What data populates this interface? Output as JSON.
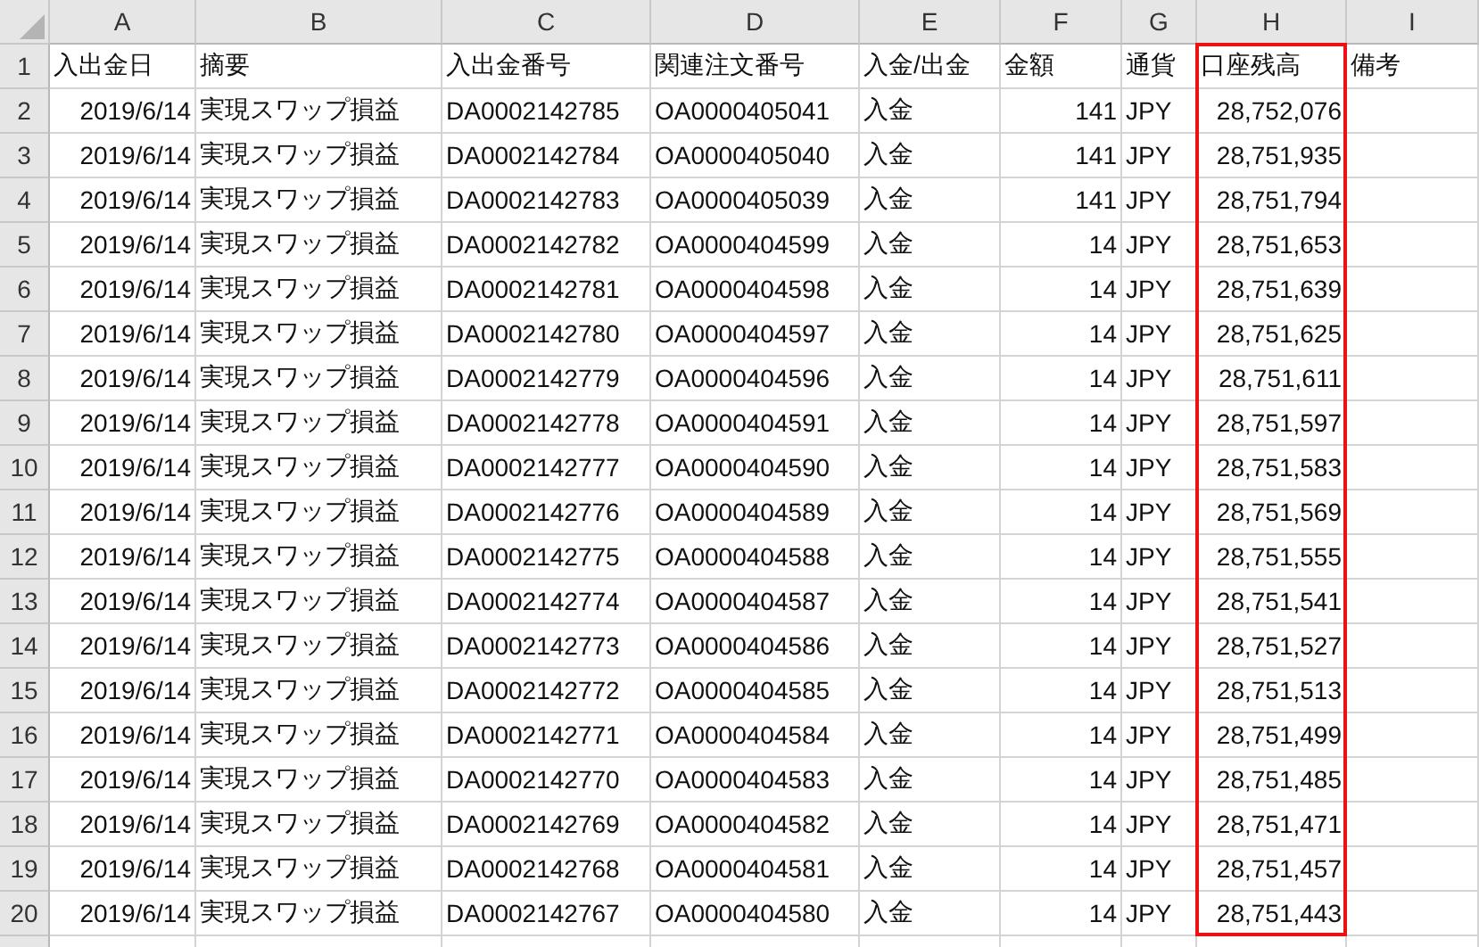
{
  "columns": [
    {
      "letter": "A",
      "highlighted": false
    },
    {
      "letter": "B",
      "highlighted": false
    },
    {
      "letter": "C",
      "highlighted": false
    },
    {
      "letter": "D",
      "highlighted": false
    },
    {
      "letter": "E",
      "highlighted": false
    },
    {
      "letter": "F",
      "highlighted": false
    },
    {
      "letter": "G",
      "highlighted": false
    },
    {
      "letter": "H",
      "highlighted": true
    },
    {
      "letter": "I",
      "highlighted": false
    }
  ],
  "header_row": {
    "number": "1",
    "cells": [
      "入出金日",
      "摘要",
      "入出金番号",
      "関連注文番号",
      "入金/出金",
      "金額",
      "通貨",
      "口座残高",
      "備考"
    ]
  },
  "rows": [
    {
      "number": "2",
      "cells": [
        "2019/6/14",
        "実現スワップ損益",
        "DA0002142785",
        "OA0000405041",
        "入金",
        "141",
        "JPY",
        "28,752,076"
      ]
    },
    {
      "number": "3",
      "cells": [
        "2019/6/14",
        "実現スワップ損益",
        "DA0002142784",
        "OA0000405040",
        "入金",
        "141",
        "JPY",
        "28,751,935"
      ]
    },
    {
      "number": "4",
      "cells": [
        "2019/6/14",
        "実現スワップ損益",
        "DA0002142783",
        "OA0000405039",
        "入金",
        "141",
        "JPY",
        "28,751,794"
      ]
    },
    {
      "number": "5",
      "cells": [
        "2019/6/14",
        "実現スワップ損益",
        "DA0002142782",
        "OA0000404599",
        "入金",
        "14",
        "JPY",
        "28,751,653"
      ]
    },
    {
      "number": "6",
      "cells": [
        "2019/6/14",
        "実現スワップ損益",
        "DA0002142781",
        "OA0000404598",
        "入金",
        "14",
        "JPY",
        "28,751,639"
      ]
    },
    {
      "number": "7",
      "cells": [
        "2019/6/14",
        "実現スワップ損益",
        "DA0002142780",
        "OA0000404597",
        "入金",
        "14",
        "JPY",
        "28,751,625"
      ]
    },
    {
      "number": "8",
      "cells": [
        "2019/6/14",
        "実現スワップ損益",
        "DA0002142779",
        "OA0000404596",
        "入金",
        "14",
        "JPY",
        "28,751,611"
      ]
    },
    {
      "number": "9",
      "cells": [
        "2019/6/14",
        "実現スワップ損益",
        "DA0002142778",
        "OA0000404591",
        "入金",
        "14",
        "JPY",
        "28,751,597"
      ]
    },
    {
      "number": "10",
      "cells": [
        "2019/6/14",
        "実現スワップ損益",
        "DA0002142777",
        "OA0000404590",
        "入金",
        "14",
        "JPY",
        "28,751,583"
      ]
    },
    {
      "number": "11",
      "cells": [
        "2019/6/14",
        "実現スワップ損益",
        "DA0002142776",
        "OA0000404589",
        "入金",
        "14",
        "JPY",
        "28,751,569"
      ]
    },
    {
      "number": "12",
      "cells": [
        "2019/6/14",
        "実現スワップ損益",
        "DA0002142775",
        "OA0000404588",
        "入金",
        "14",
        "JPY",
        "28,751,555"
      ]
    },
    {
      "number": "13",
      "cells": [
        "2019/6/14",
        "実現スワップ損益",
        "DA0002142774",
        "OA0000404587",
        "入金",
        "14",
        "JPY",
        "28,751,541"
      ]
    },
    {
      "number": "14",
      "cells": [
        "2019/6/14",
        "実現スワップ損益",
        "DA0002142773",
        "OA0000404586",
        "入金",
        "14",
        "JPY",
        "28,751,527"
      ]
    },
    {
      "number": "15",
      "cells": [
        "2019/6/14",
        "実現スワップ損益",
        "DA0002142772",
        "OA0000404585",
        "入金",
        "14",
        "JPY",
        "28,751,513"
      ]
    },
    {
      "number": "16",
      "cells": [
        "2019/6/14",
        "実現スワップ損益",
        "DA0002142771",
        "OA0000404584",
        "入金",
        "14",
        "JPY",
        "28,751,499"
      ]
    },
    {
      "number": "17",
      "cells": [
        "2019/6/14",
        "実現スワップ損益",
        "DA0002142770",
        "OA0000404583",
        "入金",
        "14",
        "JPY",
        "28,751,485"
      ]
    },
    {
      "number": "18",
      "cells": [
        "2019/6/14",
        "実現スワップ損益",
        "DA0002142769",
        "OA0000404582",
        "入金",
        "14",
        "JPY",
        "28,751,471"
      ]
    },
    {
      "number": "19",
      "cells": [
        "2019/6/14",
        "実現スワップ損益",
        "DA0002142768",
        "OA0000404581",
        "入金",
        "14",
        "JPY",
        "28,751,457"
      ]
    },
    {
      "number": "20",
      "cells": [
        "2019/6/14",
        "実現スワップ損益",
        "DA0002142767",
        "OA0000404580",
        "入金",
        "14",
        "JPY",
        "28,751,443"
      ]
    }
  ]
}
